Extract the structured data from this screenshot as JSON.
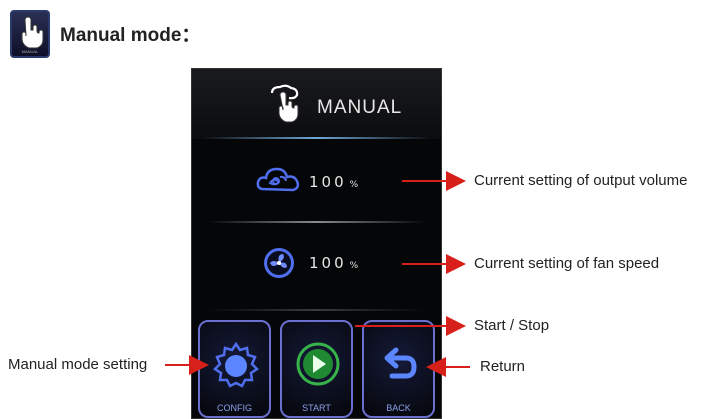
{
  "header": {
    "title": "Manual mode：",
    "icon": "manual-mode-icon"
  },
  "device": {
    "title": "MANUAL",
    "output_volume": {
      "value": "100",
      "unit": "%"
    },
    "fan_speed": {
      "value": "100",
      "unit": "%"
    },
    "buttons": {
      "config": "CONFIG",
      "start": "START",
      "back": "BACK"
    }
  },
  "callouts": {
    "output_volume": "Current setting of output volume",
    "fan_speed": "Current setting of fan speed",
    "start_stop": "Start / Stop",
    "manual_setting": "Manual mode setting",
    "return": "Return"
  },
  "colors": {
    "arrow": "#d8201a",
    "button_border": "#6a6fd0",
    "accent_blue": "#4f6ff0",
    "start_green": "#37b34a"
  }
}
